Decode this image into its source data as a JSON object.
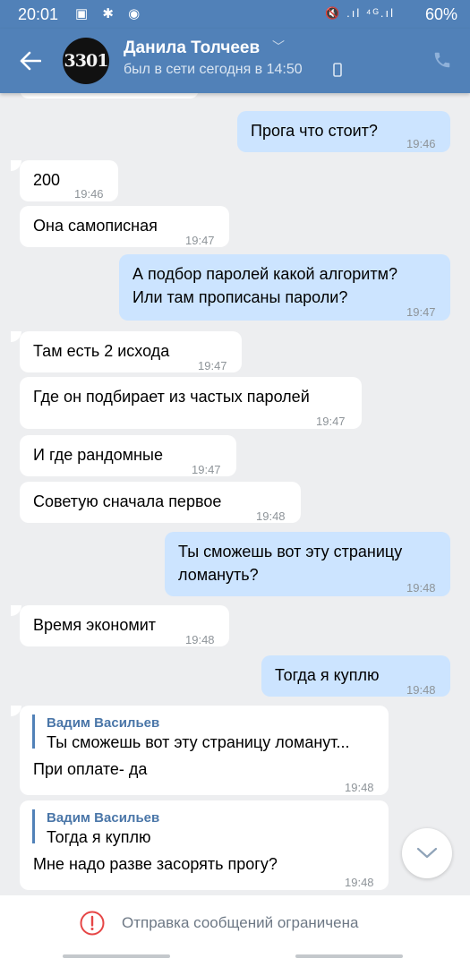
{
  "status_bar": {
    "time": "20:01",
    "left_icons": "▣ ✱ ◉",
    "right_icons": "🔇 .ıl ⁴ᴳ.ıl",
    "battery": "60%"
  },
  "header": {
    "avatar_text": "3301",
    "name": "Данила Толчеев",
    "status": "был в сети сегодня в 14:50",
    "accent": "#5181b8"
  },
  "messages": [
    {
      "dir": "out",
      "text": "Прога что стоит?",
      "time": "19:46"
    },
    {
      "dir": "in",
      "text": "200",
      "time": "19:46"
    },
    {
      "dir": "in",
      "text": "Она самописная",
      "time": "19:47"
    },
    {
      "dir": "out",
      "text": "А подбор паролей какой алгоритм?\nИли там прописаны пароли?",
      "time": "19:47"
    },
    {
      "dir": "in",
      "text": "Там есть 2 исхода",
      "time": "19:47"
    },
    {
      "dir": "in",
      "text": "Где он подбирает из частых паролей",
      "time": "19:47"
    },
    {
      "dir": "in",
      "text": "И где рандомные",
      "time": "19:47"
    },
    {
      "dir": "in",
      "text": "Советую сначала первое",
      "time": "19:48"
    },
    {
      "dir": "out",
      "text": "Ты сможешь вот эту страницу\nломануть?",
      "time": "19:48"
    },
    {
      "dir": "in",
      "text": "Время экономит",
      "time": "19:48"
    },
    {
      "dir": "out",
      "text": "Тогда я куплю",
      "time": "19:48"
    }
  ],
  "replies": [
    {
      "quote_author": "Вадим Васильев",
      "quote_text": "Ты сможешь вот эту страницу ломанут...",
      "text": "При оплате- да",
      "time": "19:48"
    },
    {
      "quote_author": "Вадим Васильев",
      "quote_text": "Тогда я куплю",
      "text": "Мне надо разве засорять прогу?",
      "time": "19:48"
    }
  ],
  "composer": {
    "restricted_text": "Отправка сообщений ограничена",
    "alert_color": "#e64646"
  }
}
